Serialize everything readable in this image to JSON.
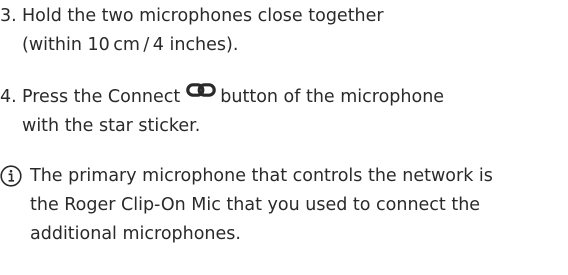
{
  "steps": [
    {
      "number": "3.",
      "line1": "Hold the two microphones close together",
      "line2": "(within 10 cm / 4 inches)."
    },
    {
      "number": "4.",
      "line1_before": "Press the Connect",
      "icon": "link-icon",
      "line1_after": "button of the microphone",
      "line2": "with the star sticker."
    }
  ],
  "note": {
    "icon": "info-icon",
    "line1": "The primary microphone that controls the network is",
    "line2": "the Roger Clip-On Mic that you used to connect the",
    "line3": "additional microphones."
  }
}
